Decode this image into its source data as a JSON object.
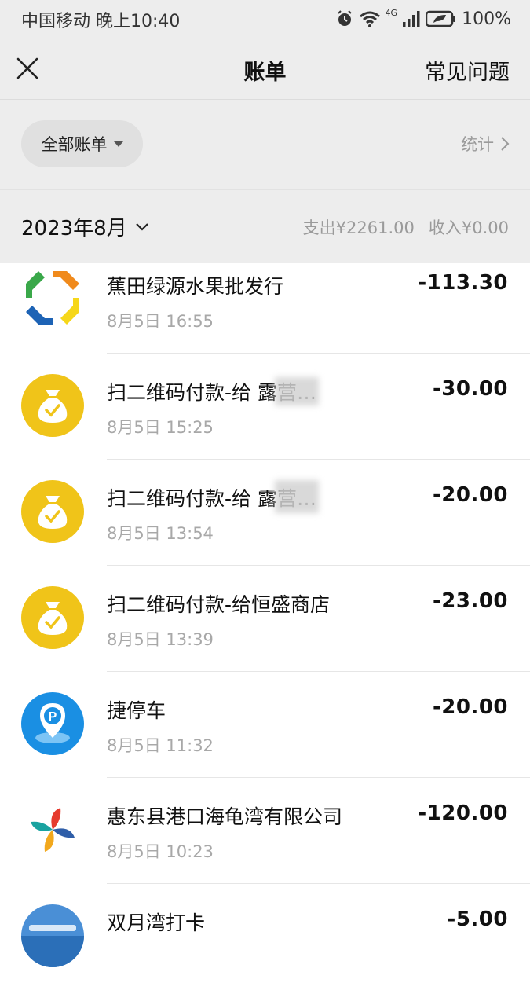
{
  "status_bar": {
    "carrier_time": "中国移动 晚上10:40",
    "network": "4G",
    "battery": "100%"
  },
  "nav": {
    "title": "账单",
    "faq_label": "常见问题"
  },
  "filter": {
    "label": "全部账单",
    "stats_label": "统计"
  },
  "month": {
    "label": "2023年8月",
    "expense": "支出¥2261.00",
    "income": "收入¥0.00"
  },
  "transactions": [
    {
      "merchant": "蕉田绿源水果批发行",
      "time": "8月5日 16:55",
      "amount": "-113.30",
      "icon": "colorful-arrows-logo-icon"
    },
    {
      "merchant": "扫二维码付款-给  露营…",
      "time": "8月5日 15:25",
      "amount": "-30.00",
      "icon": "money-bag-icon"
    },
    {
      "merchant": "扫二维码付款-给  露营…",
      "time": "8月5日 13:54",
      "amount": "-20.00",
      "icon": "money-bag-icon"
    },
    {
      "merchant": "扫二维码付款-给恒盛商店",
      "time": "8月5日 13:39",
      "amount": "-23.00",
      "icon": "money-bag-icon"
    },
    {
      "merchant": "捷停车",
      "time": "8月5日 11:32",
      "amount": "-20.00",
      "icon": "parking-icon"
    },
    {
      "merchant": "惠东县港口海龟湾有限公司",
      "time": "8月5日 10:23",
      "amount": "-120.00",
      "icon": "pinwheel-logo-icon"
    },
    {
      "merchant": "双月湾打卡",
      "time": "",
      "amount": "-5.00",
      "icon": "photo-avatar-icon"
    }
  ],
  "colors": {
    "header_bg": "#ededed",
    "bag_yellow": "#f0c419",
    "parking_blue": "#1a8fe3"
  }
}
